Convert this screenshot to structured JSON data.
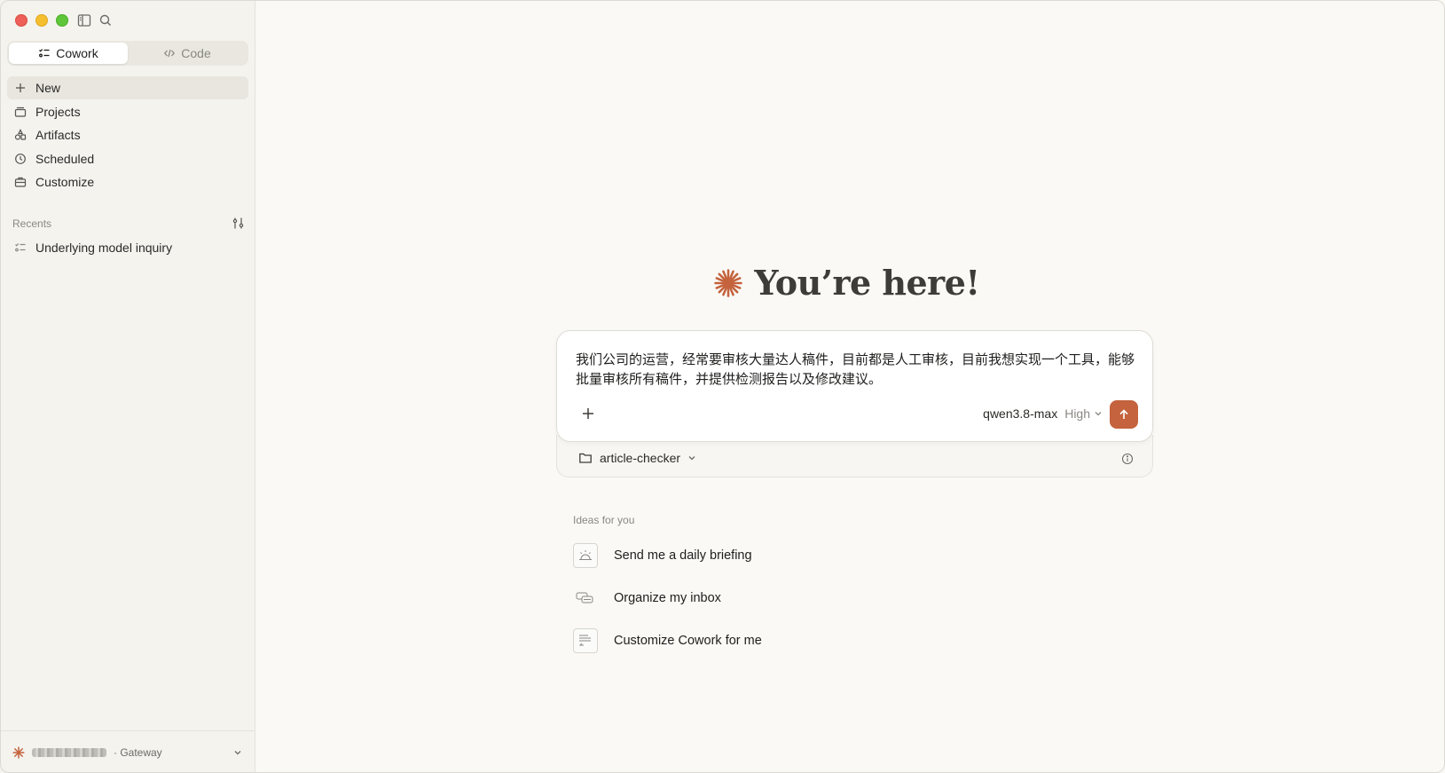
{
  "sidebar": {
    "segments": [
      {
        "label": "Cowork",
        "icon": "cowork-icon",
        "active": true
      },
      {
        "label": "Code",
        "icon": "code-icon",
        "active": false
      }
    ],
    "nav": [
      {
        "label": "New",
        "icon": "plus-icon"
      },
      {
        "label": "Projects",
        "icon": "projects-icon"
      },
      {
        "label": "Artifacts",
        "icon": "artifacts-icon"
      },
      {
        "label": "Scheduled",
        "icon": "clock-icon"
      },
      {
        "label": "Customize",
        "icon": "briefcase-icon"
      }
    ],
    "recents_label": "Recents",
    "recents": [
      {
        "label": "Underlying model inquiry",
        "icon": "task-list-icon"
      }
    ],
    "footer": {
      "suffix": "· Gateway"
    }
  },
  "main": {
    "hero_title": "You’re here!",
    "composer": {
      "text": "我们公司的运营，经常要审核大量达人稿件，目前都是人工审核，目前我想实现一个工具，能够批量审核所有稿件，并提供检测报告以及修改建议。",
      "model": "qwen3.8-max",
      "effort": "High"
    },
    "folder": "article-checker",
    "ideas_label": "Ideas for you",
    "ideas": [
      {
        "label": "Send me a daily briefing",
        "icon": "alarm-icon"
      },
      {
        "label": "Organize my inbox",
        "icon": "inbox-icon"
      },
      {
        "label": "Customize Cowork for me",
        "icon": "document-icon"
      }
    ]
  },
  "colors": {
    "accent": "#c4633d",
    "sidebar_bg": "#f4f3ee",
    "main_bg": "#faf9f5"
  }
}
